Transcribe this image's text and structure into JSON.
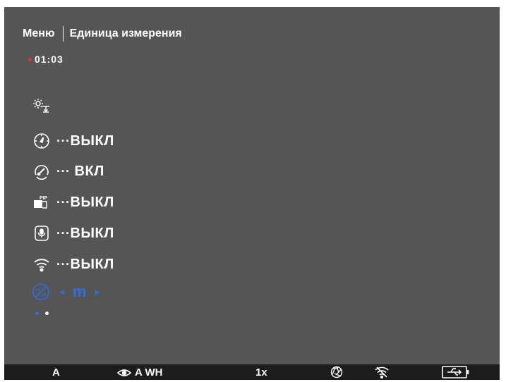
{
  "header": {
    "menu_label": "Меню",
    "title": "Единица измерения"
  },
  "recording": {
    "time": "01:03",
    "dot_color": "#e53030"
  },
  "menu_items": [
    {
      "icon": "sun-arrow-icon",
      "value": ""
    },
    {
      "icon": "compass-icon",
      "dots": "···",
      "value": "ВЫКЛ"
    },
    {
      "icon": "gauge-icon",
      "dots": "···",
      "value": "ВКЛ"
    },
    {
      "icon": "pip-icon",
      "dots": "···",
      "value": "ВЫКЛ"
    },
    {
      "icon": "microphone-icon",
      "dots": "···",
      "value": "ВЫКЛ"
    },
    {
      "icon": "wifi-icon",
      "dots": "···",
      "value": "ВЫКЛ"
    }
  ],
  "unit_selector": {
    "icon": "yards-meters-icon",
    "value": "m",
    "color": "#2f6de0"
  },
  "pager": {
    "pages": 2,
    "active_index": 0
  },
  "status_bar": {
    "mode": "A",
    "view": "A WH",
    "zoom": "1x",
    "icons": [
      "aperture-icon",
      "wifi-off-icon",
      "usb-icon"
    ]
  }
}
